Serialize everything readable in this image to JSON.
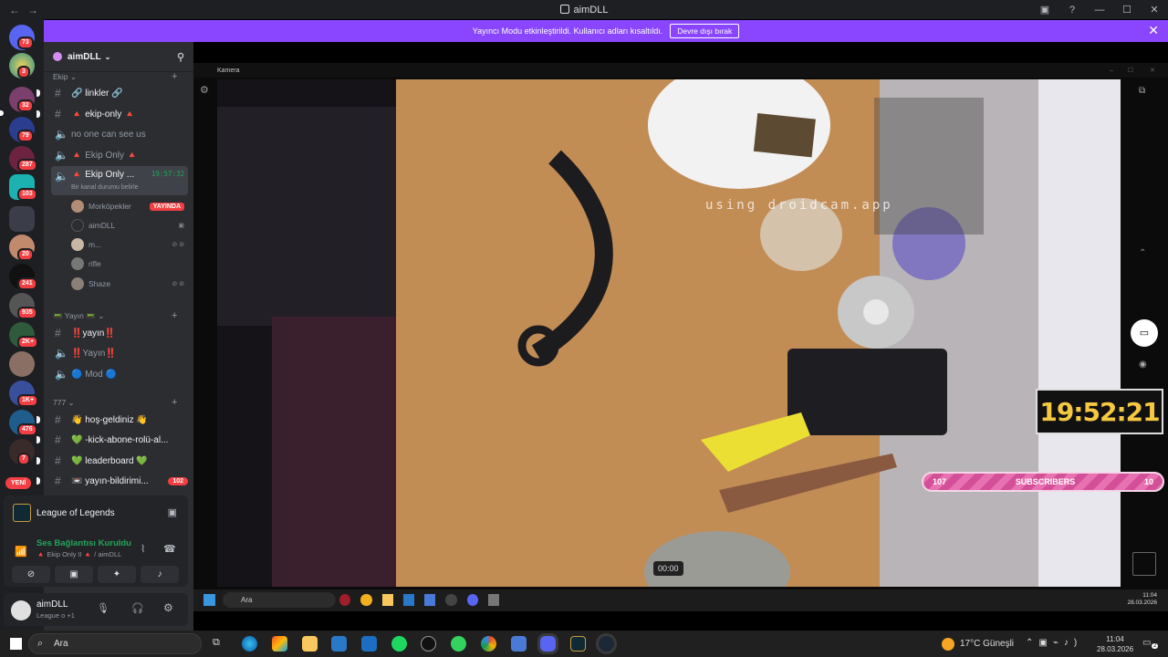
{
  "window": {
    "title": "aimDLL",
    "nav_back": "←",
    "nav_fwd": "→"
  },
  "banner": {
    "text": "Yayıncı Modu etkinleştirildi. Kullanıcı adları kısaltıldı.",
    "button": "Devre dışı bırak",
    "close": "✕"
  },
  "rail": {
    "badges": [
      "73",
      "3",
      "32",
      "79",
      "287",
      "103",
      "20",
      "241",
      "935",
      "2K+",
      "1K+",
      "476",
      "7"
    ],
    "new_label": "YENİ"
  },
  "sidebar": {
    "server_name": "aimDLL",
    "categories": [
      "Ekip",
      "📟 Yayın 📟",
      "777"
    ],
    "channels": [
      {
        "label": "🔗 linkler 🔗"
      },
      {
        "label": "🔺 ekip-only 🔺"
      },
      {
        "label": "no one can see us"
      },
      {
        "label": "🔺 Ekip Only 🔺"
      },
      {
        "label": "🔺 Ekip Only ...",
        "time": "19:57:32",
        "status": "Bir kanal durumu belirle"
      },
      {
        "label": "‼️yayın‼️"
      },
      {
        "label": "‼️Yayın‼️"
      },
      {
        "label": "🔵 Mod 🔵"
      },
      {
        "label": "👋 hoş-geldiniz 👋"
      },
      {
        "label": "💚 -kick-abone-rolü-al..."
      },
      {
        "label": "💚 leaderboard 💚"
      },
      {
        "label": "📼 yayın-bildirimi...",
        "count": "102"
      }
    ],
    "voice_users": [
      {
        "name": "Morköpekler",
        "live": "YAYINDA"
      },
      {
        "name": "aimDLL"
      },
      {
        "name": "m..."
      },
      {
        "name": "rifle"
      },
      {
        "name": "Shaze"
      }
    ]
  },
  "activity": {
    "game": "League of Legends",
    "voice_status": "Ses Bağlantısı Kuruldu",
    "voice_channel": "🔺 Ekip Only II 🔺 / aimDLL"
  },
  "user_panel": {
    "name": "aimDLL",
    "status": "League o +1"
  },
  "camera": {
    "window_title": "Kamera",
    "watermark": "using droidcam.app",
    "clock": "19:52:21",
    "subs_left": "107",
    "subs_label": "SUBSCRIBERS",
    "subs_right": "10",
    "timer": "00:00"
  },
  "inner_taskbar": {
    "search": "Ara",
    "time": "11:04",
    "date": "28.03.2026"
  },
  "taskbar": {
    "search": "Ara",
    "weather": "17°C  Güneşli",
    "time": "11:04",
    "date": "28.03.2026",
    "notif_count": "2"
  }
}
